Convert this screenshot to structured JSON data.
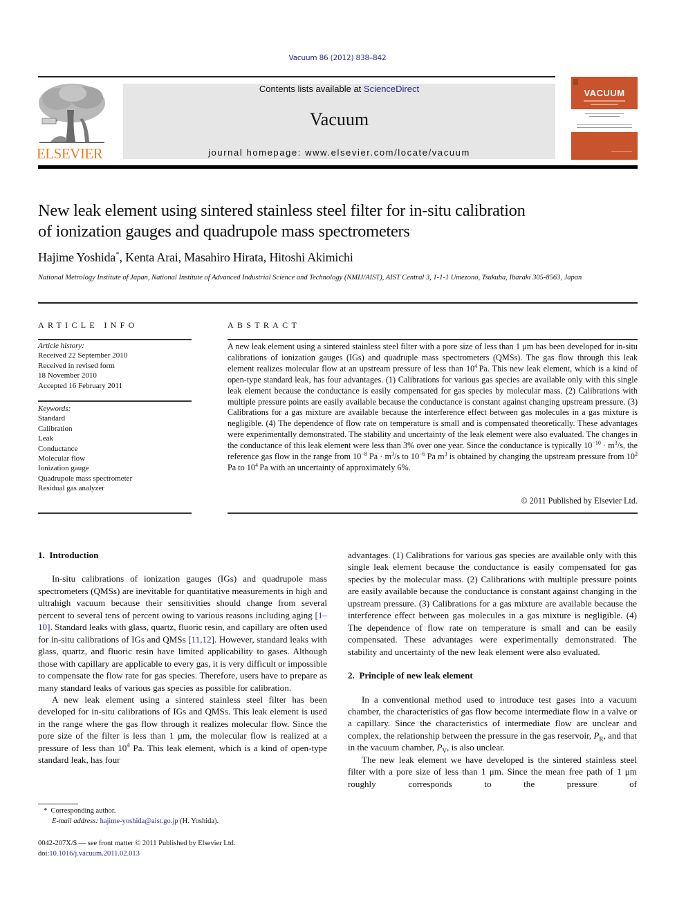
{
  "header": {
    "citation": "Vacuum 86 (2012) 838–842",
    "publisher_wordmark": "ELSEVIER",
    "contents_prefix": "Contents lists available at ",
    "contents_link": "ScienceDirect",
    "journal_name": "Vacuum",
    "homepage_prefix": "journal homepage: ",
    "homepage_url": "www.elsevier.com/locate/vacuum",
    "cover_title": "VACUUM",
    "brand_color": "#f07c1e",
    "cover_color": "#c8532c",
    "link_color": "#2a2a8c"
  },
  "article": {
    "title_line1": "New leak element using sintered stainless steel filter for in-situ calibration",
    "title_line2": "of ionization gauges and quadrupole mass spectrometers",
    "authors": [
      {
        "name": "Hajime Yoshida",
        "corresponding": "*"
      },
      {
        "name": "Kenta Arai"
      },
      {
        "name": "Masahiro Hirata"
      },
      {
        "name": "Hitoshi Akimichi"
      }
    ],
    "affiliation": "National Metrology Institute of Japan, National Institute of Advanced Industrial Science and Technology (NMIJ/AIST), AIST Central 3, 1-1-1 Umezono, Tsukuba, Ibaraki 305-8563, Japan"
  },
  "article_info": {
    "heading": "ARTICLE INFO",
    "history_label": "Article history:",
    "history": [
      "Received 22 September 2010",
      "Received in revised form",
      "18 November 2010",
      "Accepted 16 February 2011"
    ],
    "keywords_label": "Keywords:",
    "keywords": [
      "Standard",
      "Calibration",
      "Leak",
      "Conductance",
      "Molecular flow",
      "Ionization gauge",
      "Quadrupole mass spectrometer",
      "Residual gas analyzer"
    ]
  },
  "abstract": {
    "heading": "ABSTRACT",
    "p1": "A new leak element using a sintered stainless steel filter with a pore size of less than 1 μm has been developed for in-situ calibrations of ionization gauges (IGs) and quadruple mass spectrometers (QMSs). The gas flow through this leak element realizes molecular flow at an upstream pressure of less than 10",
    "p1_sup": "4",
    "p2": " Pa. This new leak element, which is a kind of open-type standard leak, has four advantages. (1) Calibrations for various gas species are available only with this single leak element because the conductance is easily compensated for gas species by molecular mass. (2) Calibrations with multiple pressure points are easily available because the conductance is constant against changing upstream pressure. (3) Calibrations for a gas mixture are available because the interference effect between gas molecules in a gas mixture is negligible. (4) The dependence of flow rate on temperature is small and is compensated theoretically. These advantages were experimentally demonstrated. The stability and uncertainty of the leak element were also evaluated. The changes in the conductance of this leak element were less than 3% over one year. Since the conductance is typically 10",
    "p2_sup": "−10",
    "p3": " · m",
    "p3_sup": "3",
    "p4": "/s, the reference gas flow in the range from 10",
    "p4_sup": "−8",
    "p5": " Pa · m",
    "p5_sup": "3",
    "p6": "/s to 10",
    "p6_sup": "−6",
    "p7": " Pa m",
    "p7_sup": "3",
    "p8": " is obtained by changing the upstream pressure from 10",
    "p8_sup": "2",
    "p9": " Pa to 10",
    "p9_sup": "4",
    "p10": " Pa with an uncertainty of approximately 6%.",
    "copyright": "© 2011 Published by Elsevier Ltd."
  },
  "body": {
    "section1_title": "1.  Introduction",
    "s1p1_a": "In-situ calibrations of ionization gauges (IGs) and quadrupole mass spectrometers (QMSs) are inevitable for quantitative measurements in high and ultrahigh vacuum because their sensitivities should change from several percent to several tens of percent owing to various reasons including aging ",
    "s1p1_ref1": "[1–10]",
    "s1p1_b": ". Standard leaks with glass, quartz, fluoric resin, and capillary are often used for in-situ calibrations of IGs and QMSs ",
    "s1p1_ref2": "[11,12]",
    "s1p1_c": ". However, standard leaks with glass, quartz, and fluoric resin have limited applicability to gases. Although those with capillary are applicable to every gas, it is very difficult or impossible to compensate the flow rate for gas species. Therefore, users have to prepare as many standard leaks of various gas species as possible for calibration.",
    "s1p2_a": "A new leak element using a sintered stainless steel filter has been developed for in-situ calibrations of IGs and QMSs. This leak element is used in the range where the gas flow through it realizes molecular flow. Since the pore size of the filter is less than 1 μm, the molecular flow is realized at a pressure of less than 10",
    "s1p2_sup": "4",
    "s1p2_b": " Pa. This leak element, which is a kind of open-type standard leak, has four",
    "s1p2_cont": "advantages. (1) Calibrations for various gas species are available only with this single leak element because the conductance is easily compensated for gas species by the molecular mass. (2) Calibrations with multiple pressure points are easily available because the conductance is constant against changing in the upstream pressure. (3) Calibrations for a gas mixture are available because the interference effect between gas molecules in a gas mixture is negligible. (4) The dependence of flow rate on temperature is small and can be easily compensated. These advantages were experimentally demonstrated. The stability and uncertainty of the new leak element were also evaluated.",
    "section2_title": "2.  Principle of new leak element",
    "s2p1_a": "In a conventional method used to introduce test gases into a vacuum chamber, the characteristics of gas flow become intermediate flow in a valve or a capillary. Since the characteristics of intermediate flow are unclear and complex, the relationship between the pressure in the gas reservoir, ",
    "s2p1_pr": "P",
    "s2p1_pr_sub": "R",
    "s2p1_b": ", and that in the vacuum chamber, ",
    "s2p1_pv": "P",
    "s2p1_pv_sub": "V",
    "s2p1_c": ", is also unclear.",
    "s2p2": "The new leak element we have developed is the sintered stainless steel filter with a pore size of less than 1 μm. Since the mean free path of 1 μm roughly corresponds to the pressure of"
  },
  "footer": {
    "corresponding_mark": "*",
    "corresponding_text": "Corresponding author.",
    "email_label": "E-mail address:",
    "email": "hajime-yoshida@aist.go.jp",
    "email_suffix": " (H. Yoshida).",
    "front_matter": "0042-207X/$ — see front matter © 2011 Published by Elsevier Ltd.",
    "doi_prefix": "doi:",
    "doi": "10.1016/j.vacuum.2011.02.013"
  }
}
